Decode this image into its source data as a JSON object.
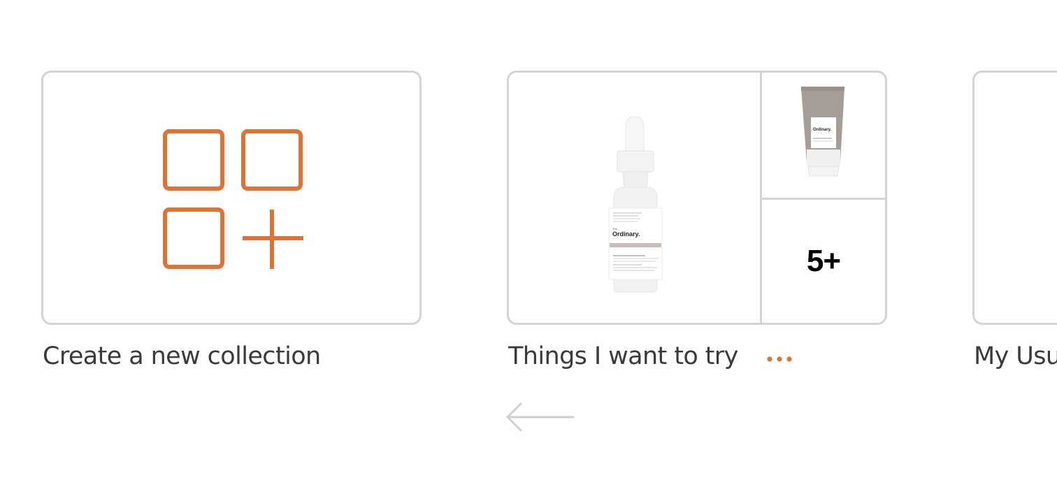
{
  "collections": [
    {
      "label": "Create a new collection",
      "icon": "add-collection-icon"
    },
    {
      "label": "Things I want to try",
      "more_count": "5+",
      "products": [
        {
          "brand": "The Ordinary.",
          "name": "Marine Hyaluronics"
        },
        {
          "brand": "The Ordinary.",
          "name": "cream tube"
        }
      ],
      "options_icon": "ellipsis-icon"
    },
    {
      "label": "My Usu"
    }
  ],
  "navigation": {
    "prev_icon": "arrow-left-icon"
  },
  "colors": {
    "accent": "#e07235",
    "border": "#d4d4d4",
    "text": "#3a3a3a",
    "arrow": "#cfcfcf"
  }
}
